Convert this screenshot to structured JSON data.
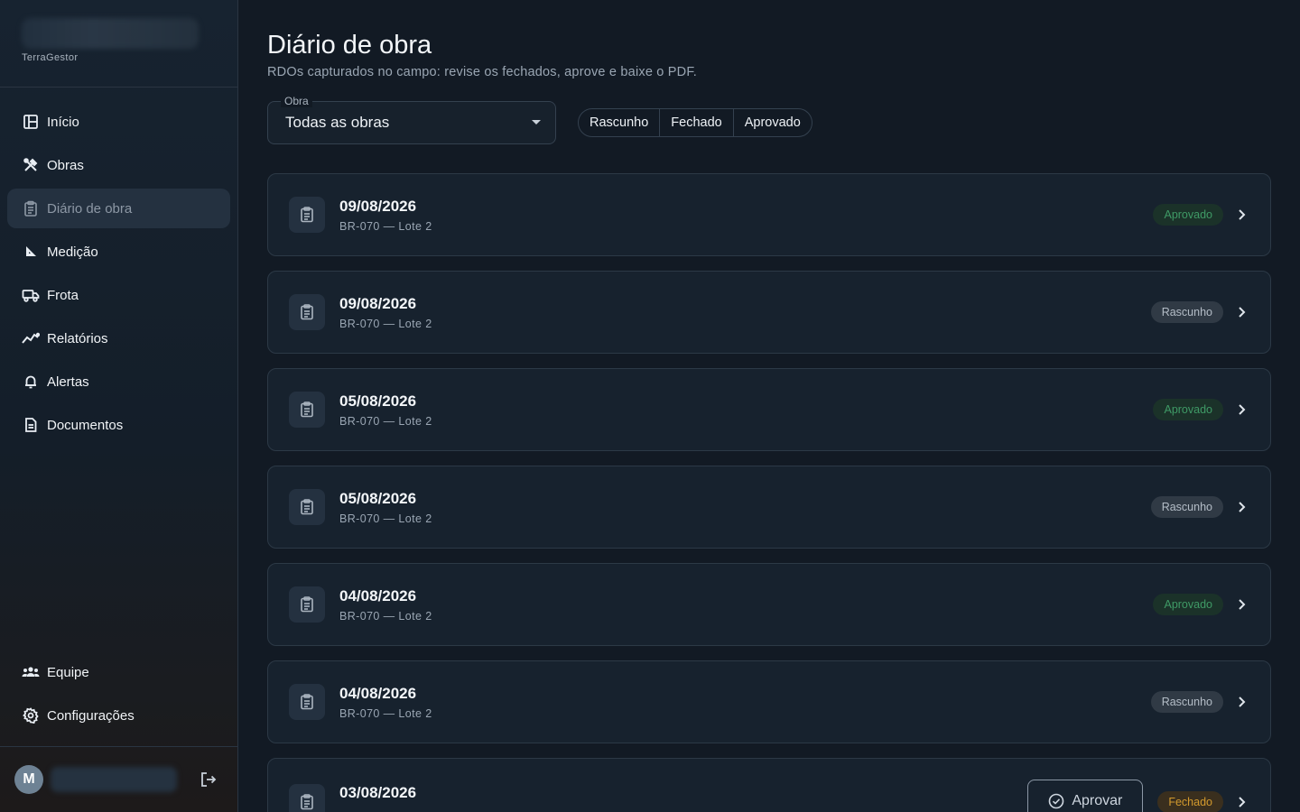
{
  "brand": {
    "name": "TerraGestor"
  },
  "sidebar": {
    "items": [
      {
        "label": "Início",
        "icon": "dashboard-icon"
      },
      {
        "label": "Obras",
        "icon": "tools-icon"
      },
      {
        "label": "Diário de obra",
        "icon": "clipboard-icon",
        "active": true
      },
      {
        "label": "Medição",
        "icon": "ruler-icon"
      },
      {
        "label": "Frota",
        "icon": "truck-icon"
      },
      {
        "label": "Relatórios",
        "icon": "chart-icon"
      },
      {
        "label": "Alertas",
        "icon": "bell-icon"
      },
      {
        "label": "Documentos",
        "icon": "document-icon"
      }
    ],
    "bottom_items": [
      {
        "label": "Equipe",
        "icon": "team-icon"
      },
      {
        "label": "Configurações",
        "icon": "gear-icon"
      }
    ],
    "user": {
      "initial": "M"
    }
  },
  "page": {
    "title": "Diário de obra",
    "subtitle": "RDOs capturados no campo: revise os fechados, aprove e baixe o PDF."
  },
  "filters": {
    "obra_label": "Obra",
    "obra_value": "Todas as obras",
    "status_options": [
      "Rascunho",
      "Fechado",
      "Aprovado"
    ]
  },
  "entries": [
    {
      "date": "09/08/2026",
      "obra": "BR-070 — Lote 2",
      "status": "Aprovado"
    },
    {
      "date": "09/08/2026",
      "obra": "BR-070 — Lote 2",
      "status": "Rascunho"
    },
    {
      "date": "05/08/2026",
      "obra": "BR-070 — Lote 2",
      "status": "Aprovado"
    },
    {
      "date": "05/08/2026",
      "obra": "BR-070 — Lote 2",
      "status": "Rascunho"
    },
    {
      "date": "04/08/2026",
      "obra": "BR-070 — Lote 2",
      "status": "Aprovado"
    },
    {
      "date": "04/08/2026",
      "obra": "BR-070 — Lote 2",
      "status": "Rascunho"
    },
    {
      "date": "03/08/2026",
      "obra": "",
      "status": "Fechado",
      "action": "Aprovar"
    }
  ],
  "colors": {
    "background": "#121a24",
    "sidebar": "#172330",
    "card": "#17222e",
    "approved": "#3f9a66",
    "draft": "#b4bdc7",
    "closed": "#d39a2d"
  }
}
